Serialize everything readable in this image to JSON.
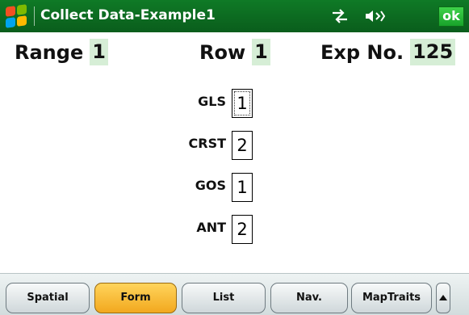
{
  "titlebar": {
    "title": "Collect Data-Example1",
    "ok_label": "ok",
    "icons": [
      "windows-start-icon",
      "connectivity-icon",
      "volume-icon"
    ]
  },
  "header": {
    "range_label": "Range",
    "range_value": "1",
    "row_label": "Row",
    "row_value": "1",
    "exp_label": "Exp No.",
    "exp_value": "125"
  },
  "form": {
    "fields": [
      {
        "label": "GLS",
        "value": "1"
      },
      {
        "label": "CRST",
        "value": "2"
      },
      {
        "label": "GOS",
        "value": "1"
      },
      {
        "label": "ANT",
        "value": "2"
      }
    ]
  },
  "tabs": {
    "active": "Form",
    "items": [
      {
        "label": "Spatial"
      },
      {
        "label": "Form"
      },
      {
        "label": "List"
      },
      {
        "label": "Nav."
      },
      {
        "label": "MapTraits"
      }
    ]
  },
  "colors": {
    "titlebar_green": "#0f7a26",
    "value_highlight": "#d6eed6",
    "active_tab": "#f2a81e"
  }
}
